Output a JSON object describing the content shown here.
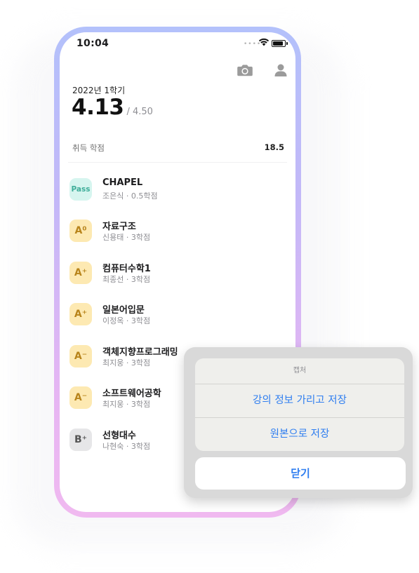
{
  "status_bar": {
    "time": "10:04"
  },
  "header": {
    "camera_icon": "camera-icon",
    "profile_icon": "person-icon"
  },
  "summary": {
    "semester": "2022년 1학기",
    "gpa": "4.13",
    "gpa_max": "/ 4.50",
    "credits_label": "취득 학점",
    "credits_value": "18.5"
  },
  "courses": [
    {
      "grade": "Pass",
      "title": "CHAPEL",
      "subtitle": "조은식 · 0.5학점",
      "style": "pass"
    },
    {
      "grade": "A⁰",
      "title": "자료구조",
      "subtitle": "신용태 · 3학점",
      "style": "gold"
    },
    {
      "grade": "A⁺",
      "title": "컴퓨터수학1",
      "subtitle": "최종선 · 3학점",
      "style": "gold"
    },
    {
      "grade": "A⁺",
      "title": "일본어입문",
      "subtitle": "이정옥 · 3학점",
      "style": "gold"
    },
    {
      "grade": "A⁻",
      "title": "객체지향프로그래밍",
      "subtitle": "최지웅 · 3학점",
      "style": "gold"
    },
    {
      "grade": "A⁻",
      "title": "소프트웨어공학",
      "subtitle": "최지웅 · 3학점",
      "style": "gold"
    },
    {
      "grade": "B⁺",
      "title": "선형대수",
      "subtitle": "나현숙 · 3학점",
      "style": "gray"
    }
  ],
  "action_sheet": {
    "title": "캡처",
    "options": [
      "강의 정보 가리고 저장",
      "원본으로 저장"
    ],
    "cancel": "닫기"
  },
  "colors": {
    "accent": "#2f7ef0",
    "pass_bg": "#d6f5ef",
    "grade_gold_bg": "#fde9b2",
    "grade_gray_bg": "#e6e6e8"
  }
}
